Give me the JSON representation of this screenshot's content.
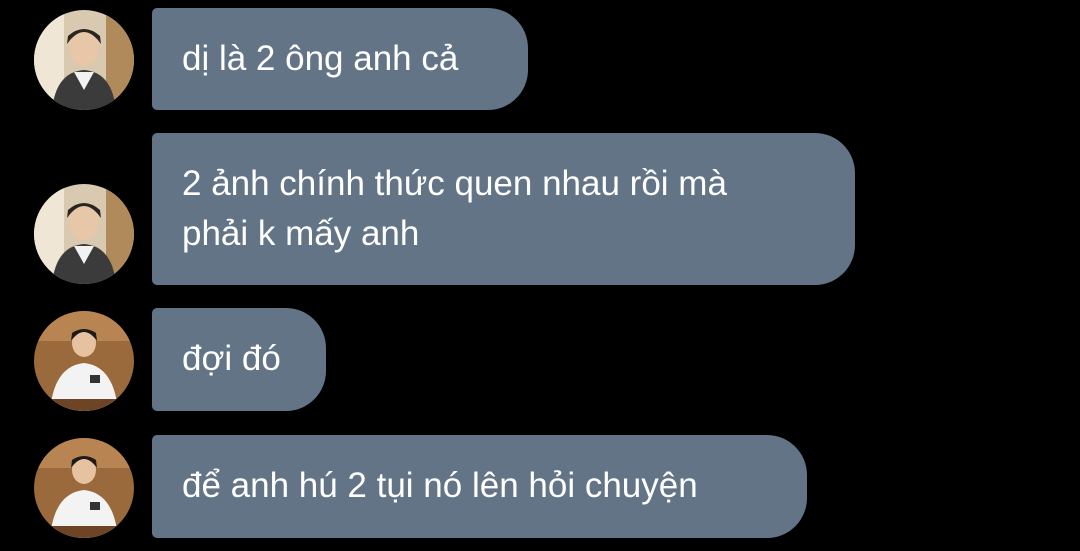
{
  "messages": [
    {
      "avatar": "avatar-user-a",
      "text": "dị là 2 ông anh cả"
    },
    {
      "avatar": "avatar-user-a",
      "text_line1": "2 ảnh chính thức quen nhau rồi mà",
      "text_line2": "phải k mấy anh"
    },
    {
      "avatar": "avatar-user-b",
      "text": "đợi đó"
    },
    {
      "avatar": "avatar-user-b",
      "text": "để anh hú 2 tụi nó lên hỏi chuyện"
    }
  ],
  "colors": {
    "background": "#000000",
    "bubble": "#637486",
    "text": "#ffffff"
  }
}
